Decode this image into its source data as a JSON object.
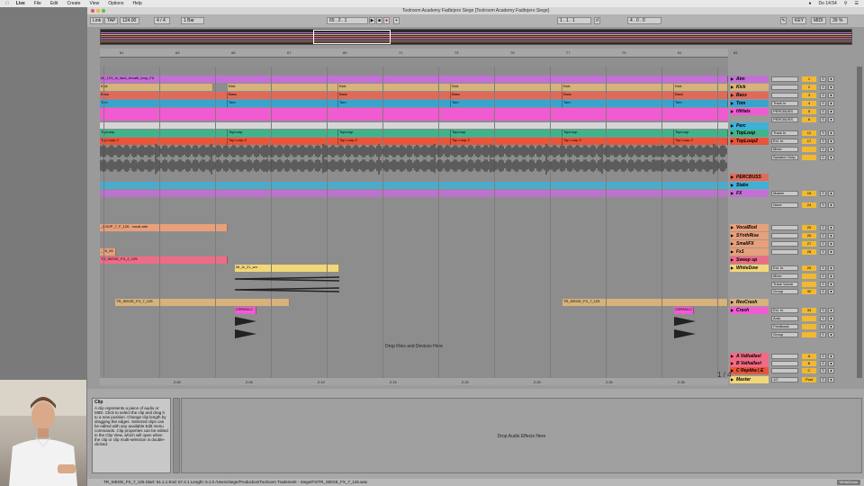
{
  "macos": {
    "menu": [
      "Live",
      "File",
      "Edit",
      "Create",
      "View",
      "Options",
      "Help"
    ],
    "clock": "Do 14:54"
  },
  "window": {
    "title": "Toolroom Academy Fadbrjero Siege  [Toolroom Academy Fadbrjero Siege]"
  },
  "transport": {
    "link": "Link",
    "tap": "TAP",
    "tempo": "124.00",
    "signature": "4 / 4",
    "quantize": "1 Bar",
    "position": "65 .  2 .  1",
    "loop_start": "1 .  1 .  1",
    "loop_length": "4 .  0 .  0",
    "key": "KEY",
    "midi": "MIDI",
    "cpu": "39 %"
  },
  "ruler": {
    "bars": [
      "61",
      "63",
      "65",
      "67",
      "69",
      "71",
      "73",
      "75",
      "77",
      "79",
      "81",
      "83"
    ]
  },
  "timeline": {
    "times": [
      "2:00",
      "2:05",
      "2:10",
      "2:15",
      "2:20",
      "2:25",
      "2:30",
      "2:35"
    ],
    "page": "1 / 4"
  },
  "tracks": [
    {
      "name": "Atm",
      "color": "#c36fd6",
      "clips": [
        {
          "label": "Mt_123_bl_dark_breath_loop_F#",
          "from": 0,
          "to": 698
        }
      ]
    },
    {
      "name": "Kick",
      "color": "#d7b27a",
      "clips": [
        {
          "label": "Kick",
          "from": 0,
          "to": 126
        },
        {
          "label": "Kick",
          "from": 142,
          "to": 265
        },
        {
          "label": "Kick",
          "from": 265,
          "to": 390
        },
        {
          "label": "Kick",
          "from": 390,
          "to": 514
        },
        {
          "label": "Kick",
          "from": 514,
          "to": 638
        },
        {
          "label": "Kick",
          "from": 638,
          "to": 698
        }
      ]
    },
    {
      "name": "Bass",
      "color": "#e06a5a",
      "clips": [
        {
          "label": "Bass",
          "from": 0,
          "to": 142
        },
        {
          "label": "Bass",
          "from": 142,
          "to": 265
        },
        {
          "label": "Bass",
          "from": 265,
          "to": 390
        },
        {
          "label": "Bass",
          "from": 390,
          "to": 514
        },
        {
          "label": "Bass",
          "from": 514,
          "to": 638
        },
        {
          "label": "Bass",
          "from": 638,
          "to": 698
        }
      ]
    },
    {
      "name": "Tom",
      "color": "#39a3d0",
      "clips": [
        {
          "label": "Tom",
          "from": 0,
          "to": 142
        },
        {
          "label": "Tom",
          "from": 142,
          "to": 265
        },
        {
          "label": "Tom",
          "from": 265,
          "to": 390
        },
        {
          "label": "Tom",
          "from": 390,
          "to": 514
        },
        {
          "label": "Tom",
          "from": 514,
          "to": 638
        },
        {
          "label": "Tom",
          "from": 638,
          "to": 698
        }
      ]
    },
    {
      "name": "HiHats",
      "color": "#f05bd2",
      "clips": []
    },
    {
      "name": "Perc",
      "color": "#3fb0d8",
      "clips": []
    },
    {
      "name": "TopLoop",
      "color": "#41b38a",
      "clips": [
        {
          "label": "TopLoop",
          "from": 0,
          "to": 142
        },
        {
          "label": "TopLoop",
          "from": 142,
          "to": 265
        },
        {
          "label": "TopLoop",
          "from": 265,
          "to": 390
        },
        {
          "label": "TopLoop",
          "from": 390,
          "to": 514
        },
        {
          "label": "TopLoop",
          "from": 514,
          "to": 638
        },
        {
          "label": "TopLoop",
          "from": 638,
          "to": 698
        }
      ]
    },
    {
      "name": "TopLoop2",
      "color": "#e8553a",
      "clips": [
        {
          "label": "Top Loop 2",
          "from": 0,
          "to": 142
        },
        {
          "label": "Top Loop 2",
          "from": 142,
          "to": 265
        },
        {
          "label": "Top Loop 2",
          "from": 265,
          "to": 390
        },
        {
          "label": "Top Loop 2",
          "from": 390,
          "to": 514
        },
        {
          "label": "Top Loop 2",
          "from": 514,
          "to": 638
        },
        {
          "label": "Top Loop 2",
          "from": 638,
          "to": 698
        }
      ]
    },
    {
      "name": "PERCBUSS",
      "color": "#e06a5a",
      "clips": []
    },
    {
      "name": "Stabs",
      "color": "#3fb0d8",
      "clips": []
    },
    {
      "name": "FX",
      "color": "#c36fd6",
      "clips": []
    },
    {
      "name": "VocalBod",
      "color": "#e8a07a",
      "clips": [
        {
          "label": "_LOOP_7_F_126 - vocal atm",
          "from": 0,
          "to": 142
        }
      ]
    },
    {
      "name": "SYnthRise",
      "color": "#e8a07a",
      "clips": []
    },
    {
      "name": "SmallFX",
      "color": "#e8a07a",
      "clips": []
    },
    {
      "name": "Fx1",
      "color": "#e8a07a",
      "clips": [
        {
          "label": "_TA_Mi",
          "from": 0,
          "to": 18
        }
      ]
    },
    {
      "name": "Sweep up",
      "color": "#f06b86",
      "clips": [
        {
          "label": "TR_SIEGE_FX_2_125",
          "from": 0,
          "to": 142
        }
      ]
    },
    {
      "name": "WhiteDow",
      "color": "#f2d779",
      "clips": [
        {
          "label": "Mt_fx_21_wn",
          "from": 150,
          "to": 266
        }
      ]
    },
    {
      "name": "RevCrash",
      "color": "#d7b27a",
      "clips": [
        {
          "label": "TR_SIEGE_FX_7_125",
          "from": 17,
          "to": 211
        },
        {
          "label": "TR_SIEGE_FX_7_125",
          "from": 514,
          "to": 698
        }
      ]
    },
    {
      "name": "Crash",
      "color": "#f05bd2",
      "clips": [
        {
          "label": "CSP834.C",
          "from": 150,
          "to": 174
        },
        {
          "label": "CSP834.C",
          "from": 638,
          "to": 660
        }
      ]
    },
    {
      "name": "A Valhallavi",
      "color": "#f06b86",
      "clips": []
    },
    {
      "name": "B Valhallavi",
      "color": "#f06b86",
      "clips": []
    },
    {
      "name": "C Replika | E",
      "color": "#e8553a",
      "clips": []
    },
    {
      "name": "Master",
      "color": "#f2d779",
      "clips": []
    }
  ],
  "drop_area_text": "Drop Files and Devices Here",
  "mixer": {
    "rows": [
      {
        "io": "",
        "num": "1"
      },
      {
        "io": "",
        "num": "2"
      },
      {
        "io": "",
        "num": "3"
      },
      {
        "io": "Track In",
        "num": "4"
      },
      {
        "io": "PERCBUSS",
        "num": "5"
      },
      {
        "io": "PERCBUSS",
        "num": "6"
      },
      {
        "io": "Track In",
        "num": "12"
      },
      {
        "io": "Ext. In",
        "num": "17"
      },
      {
        "io": "Mixer",
        "num": ""
      },
      {
        "io": "Speaker Outp",
        "num": ""
      },
      {
        "io": "Master",
        "num": "18"
      },
      {
        "io": "None",
        "num": "24"
      },
      {
        "io": "",
        "num": "25"
      },
      {
        "io": "",
        "num": "26"
      },
      {
        "io": "",
        "num": "27"
      },
      {
        "io": "",
        "num": "28"
      },
      {
        "io": "Ext. In",
        "num": "29"
      },
      {
        "io": "Mixer",
        "num": ""
      },
      {
        "io": "Track Volum",
        "num": ""
      },
      {
        "io": "Group",
        "num": "30"
      },
      {
        "io": "Ext. In",
        "num": "33"
      },
      {
        "io": "Auto",
        "num": ""
      },
      {
        "io": "Feedback",
        "num": ""
      },
      {
        "io": "Group",
        "num": ""
      },
      {
        "io": "",
        "num": "A"
      },
      {
        "io": "",
        "num": "B"
      },
      {
        "io": "",
        "num": "C"
      },
      {
        "io": "1/2",
        "num": "Post"
      }
    ]
  },
  "info_view": {
    "title": "Clip",
    "text": "A clip represents a piece of audio or MIDI. Click to select the clip and drag it to a new position. Change clip length by dragging the edges. Selected clips can be edited with any available Edit menu commands. Clip properties can be edited in the Clip View, which will open when the clip or clip multi-selection is double-clicked."
  },
  "device_area_text": "Drop Audio Effects Here",
  "status_bar": {
    "text": "TR_SIEGE_FX_7_125  Start: 61.1.1  End: 67.2.1  Length: 6.1.0  /Users/siege/Production/Toolroom Trademark - Siege/FX/TR_SIEGE_FX_7_125.wav",
    "right": "WhiteDown"
  }
}
